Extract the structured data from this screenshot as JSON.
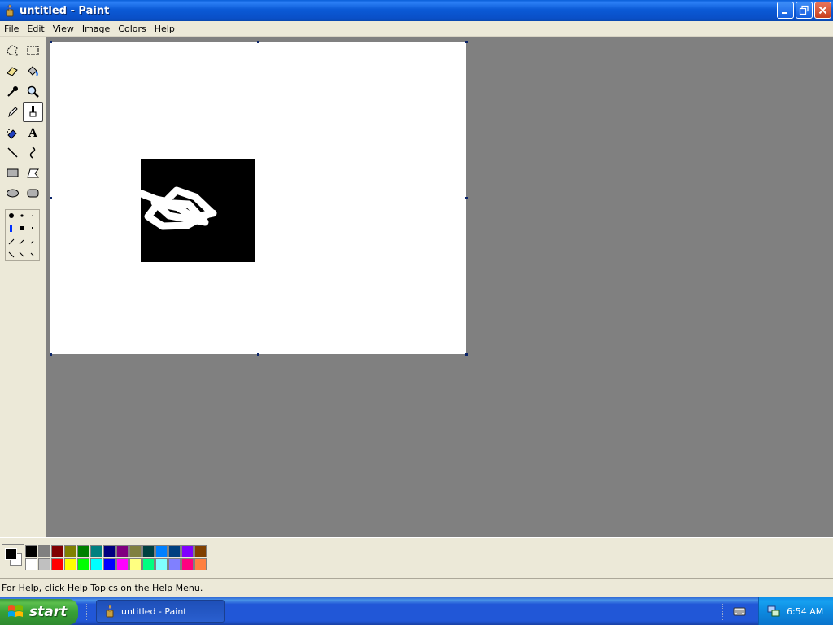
{
  "window": {
    "title": "untitled - Paint",
    "icon": "paint-brush-cup-icon"
  },
  "menu": {
    "items": [
      {
        "label": "File"
      },
      {
        "label": "Edit"
      },
      {
        "label": "View"
      },
      {
        "label": "Image"
      },
      {
        "label": "Colors"
      },
      {
        "label": "Help"
      }
    ]
  },
  "tools": [
    {
      "name": "free-form-select",
      "icon": "free-form-select-icon"
    },
    {
      "name": "select",
      "icon": "rect-select-icon"
    },
    {
      "name": "eraser",
      "icon": "eraser-icon"
    },
    {
      "name": "fill-with-color",
      "icon": "fill-bucket-icon"
    },
    {
      "name": "pick-color",
      "icon": "eyedropper-icon"
    },
    {
      "name": "magnifier",
      "icon": "magnifier-icon"
    },
    {
      "name": "pencil",
      "icon": "pencil-icon"
    },
    {
      "name": "brush",
      "icon": "brush-icon",
      "active": true
    },
    {
      "name": "airbrush",
      "icon": "airbrush-icon"
    },
    {
      "name": "text",
      "icon": "text-icon"
    },
    {
      "name": "line",
      "icon": "line-icon"
    },
    {
      "name": "curve",
      "icon": "curve-icon"
    },
    {
      "name": "rectangle",
      "icon": "rectangle-icon"
    },
    {
      "name": "polygon",
      "icon": "polygon-icon"
    },
    {
      "name": "ellipse",
      "icon": "ellipse-icon"
    },
    {
      "name": "rounded-rectangle",
      "icon": "rounded-rectangle-icon"
    }
  ],
  "colors": {
    "foreground": "#000000",
    "background": "#ffffff",
    "palette_row1": [
      "#000000",
      "#808080",
      "#800000",
      "#808000",
      "#008000",
      "#008080",
      "#000080",
      "#800080",
      "#808040",
      "#004040",
      "#0080ff",
      "#004080",
      "#8000ff",
      "#804000"
    ],
    "palette_row2": [
      "#ffffff",
      "#c0c0c0",
      "#ff0000",
      "#ffff00",
      "#00ff00",
      "#00ffff",
      "#0000ff",
      "#ff00ff",
      "#ffff80",
      "#00ff80",
      "#80ffff",
      "#8080ff",
      "#ff0080",
      "#ff8040"
    ]
  },
  "status": {
    "help_text": "For Help, click Help Topics on the Help Menu."
  },
  "taskbar": {
    "start_label": "start",
    "task_label": "untitled - Paint",
    "clock": "6:54 AM"
  }
}
